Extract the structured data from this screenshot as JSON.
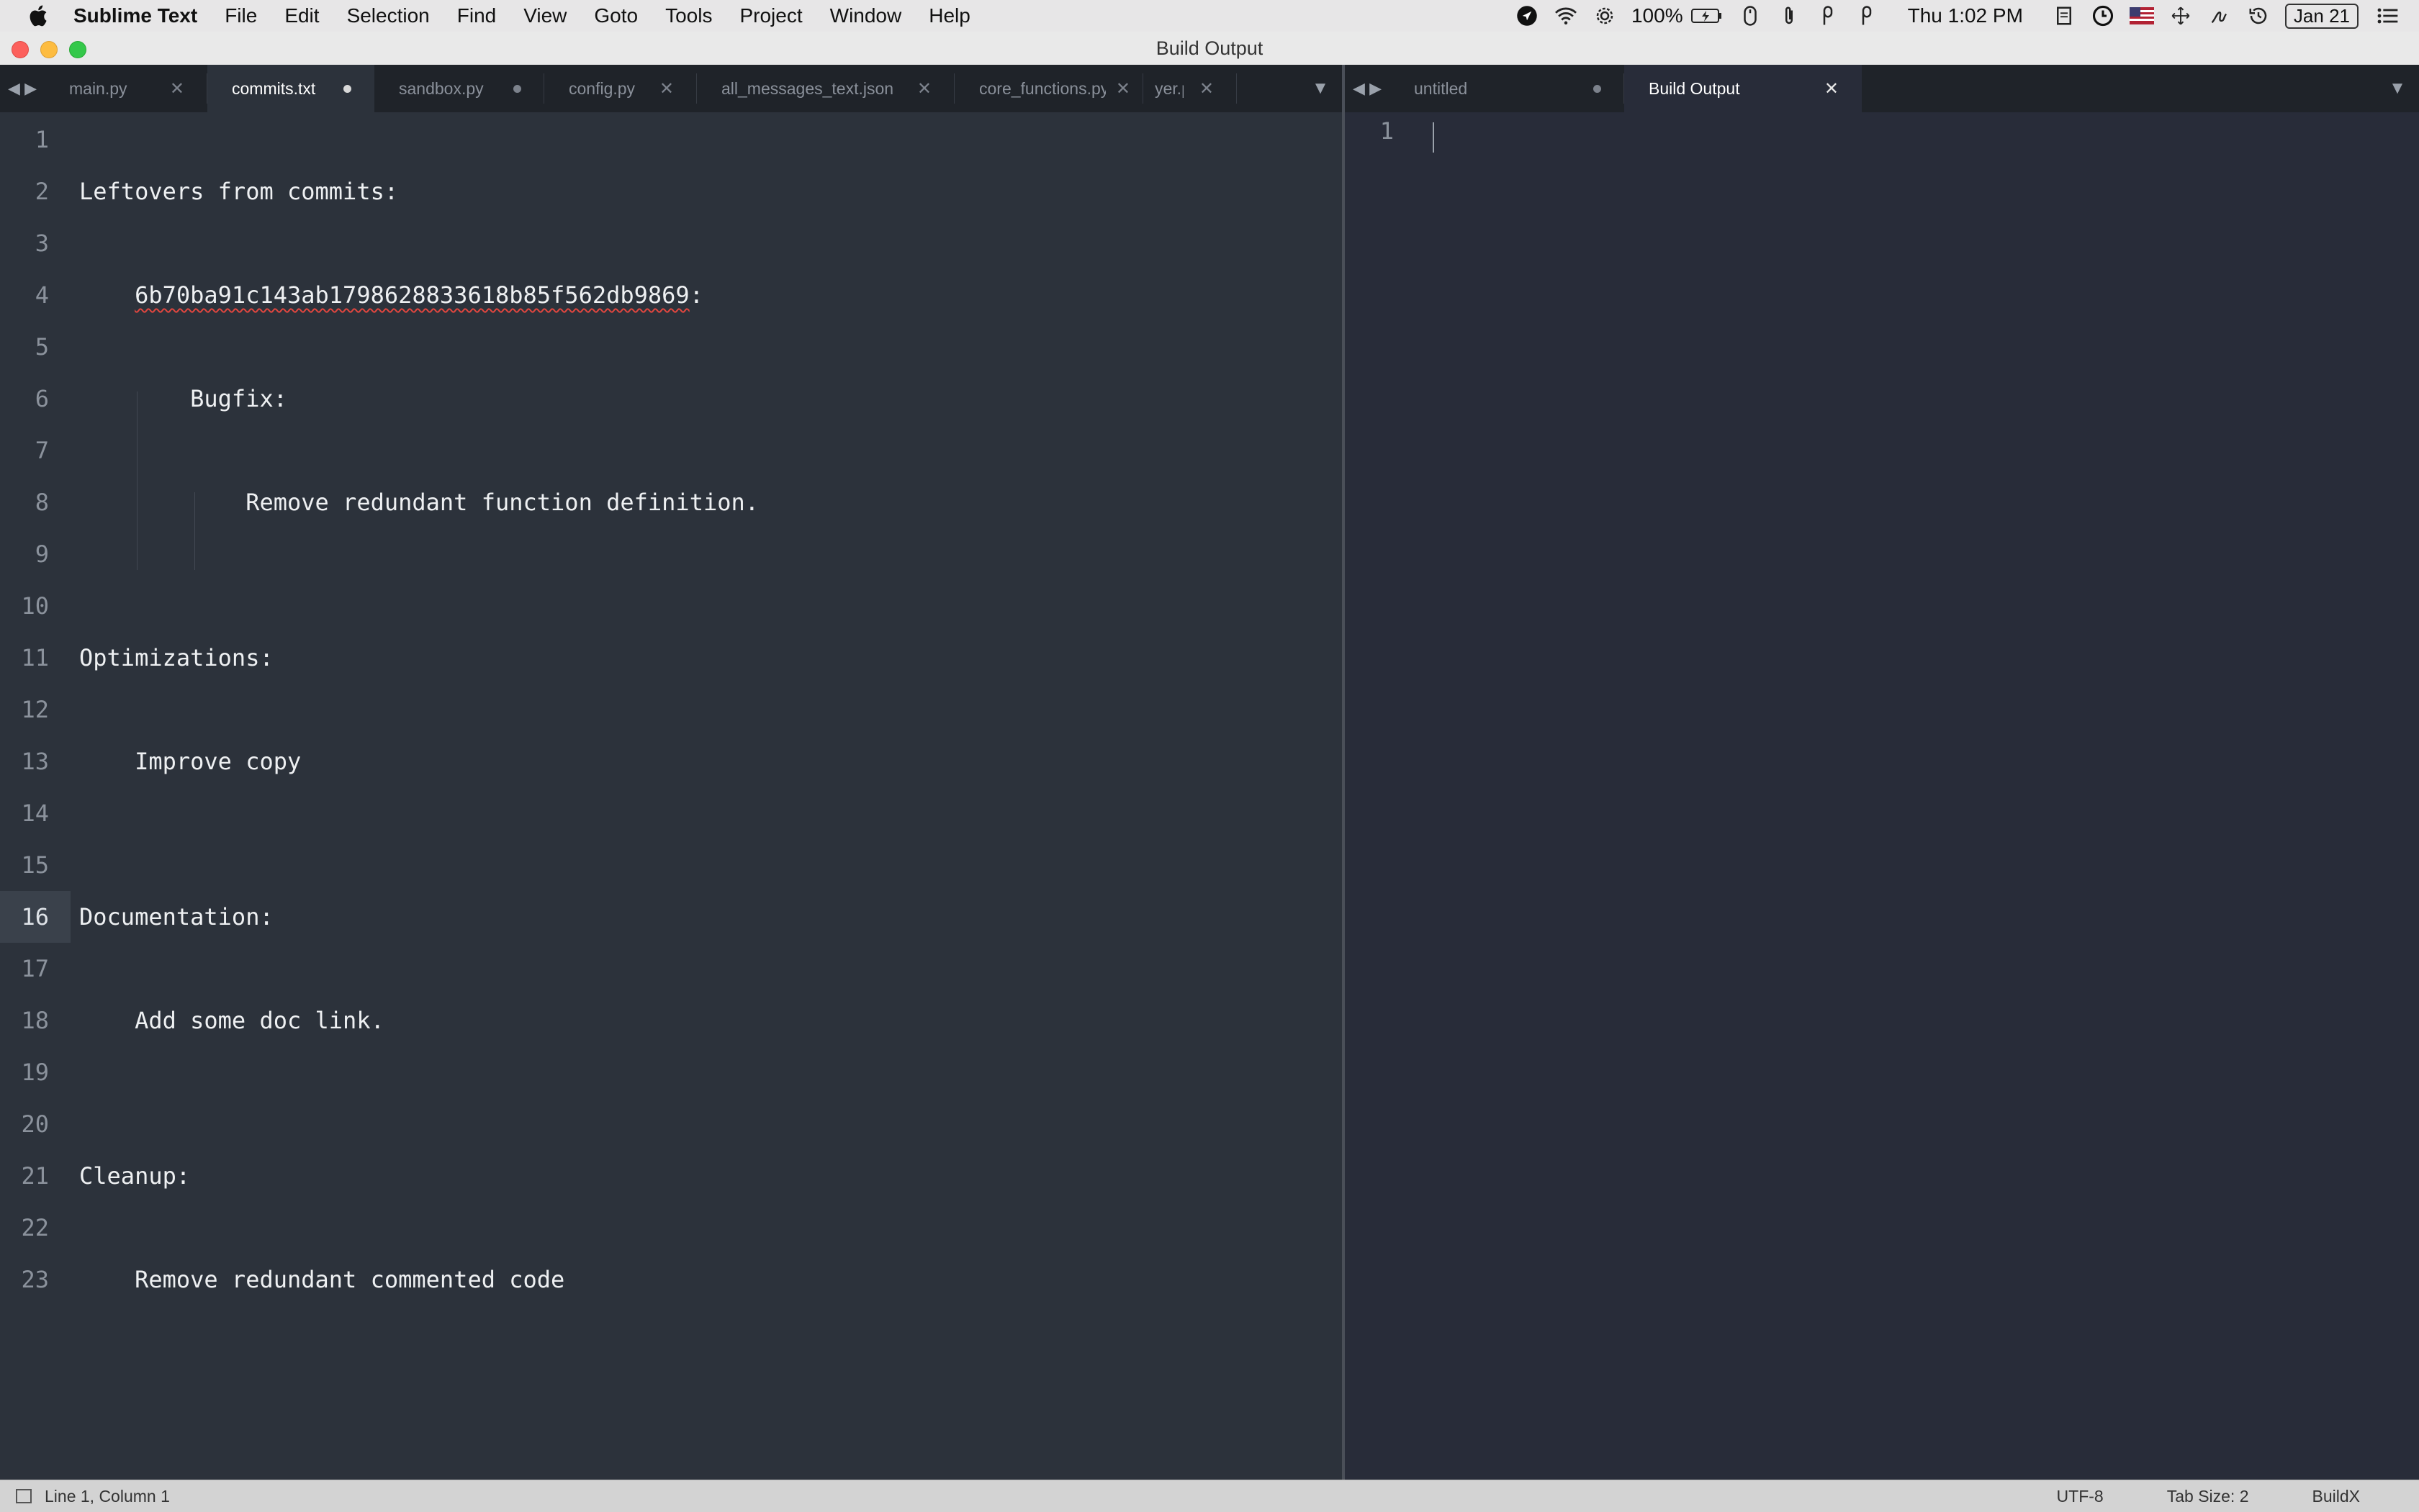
{
  "menubar": {
    "app_name": "Sublime Text",
    "items": [
      "File",
      "Edit",
      "Selection",
      "Find",
      "View",
      "Goto",
      "Tools",
      "Project",
      "Window",
      "Help"
    ],
    "battery": "100%",
    "clock": "Thu 1:02 PM",
    "date": "Jan 21"
  },
  "window": {
    "title": "Build Output"
  },
  "left_pane": {
    "tabs": [
      {
        "label": "main.py",
        "state": "close",
        "active": false
      },
      {
        "label": "commits.txt",
        "state": "dirty",
        "active": true
      },
      {
        "label": "sandbox.py",
        "state": "dirty",
        "active": false
      },
      {
        "label": "config.py",
        "state": "close",
        "active": false
      },
      {
        "label": "all_messages_text.json",
        "state": "close",
        "active": false
      },
      {
        "label": "core_functions.py",
        "state": "close",
        "active": false
      },
      {
        "label": "yer.py",
        "state": "close",
        "active": false
      }
    ],
    "lines": [
      {
        "n": "1",
        "text": ""
      },
      {
        "n": "2",
        "text": "Leftovers from commits:"
      },
      {
        "n": "3",
        "text": ""
      },
      {
        "n": "4",
        "text": "    6b70ba91c143ab1798628833618b85f562db9869:"
      },
      {
        "n": "5",
        "text": ""
      },
      {
        "n": "6",
        "text": "        Bugfix:"
      },
      {
        "n": "7",
        "text": ""
      },
      {
        "n": "8",
        "text": "            Remove redundant function definition."
      },
      {
        "n": "9",
        "text": ""
      },
      {
        "n": "10",
        "text": ""
      },
      {
        "n": "11",
        "text": "Optimizations:"
      },
      {
        "n": "12",
        "text": ""
      },
      {
        "n": "13",
        "text": "    Improve copy"
      },
      {
        "n": "14",
        "text": ""
      },
      {
        "n": "15",
        "text": ""
      },
      {
        "n": "16",
        "text": "Documentation:"
      },
      {
        "n": "17",
        "text": ""
      },
      {
        "n": "18",
        "text": "    Add some doc link."
      },
      {
        "n": "19",
        "text": ""
      },
      {
        "n": "20",
        "text": ""
      },
      {
        "n": "21",
        "text": "Cleanup:"
      },
      {
        "n": "22",
        "text": ""
      },
      {
        "n": "23",
        "text": "    Remove redundant commented code"
      }
    ],
    "current_line": "16"
  },
  "right_pane": {
    "tabs": [
      {
        "label": "untitled",
        "state": "dirty",
        "active": false
      },
      {
        "label": "Build Output",
        "state": "close",
        "active": true
      }
    ],
    "lines": [
      {
        "n": "1",
        "text": ""
      }
    ]
  },
  "statusbar": {
    "position": "Line 1, Column 1",
    "encoding": "UTF-8",
    "tab_size": "Tab Size: 2",
    "build_system": "BuildX"
  },
  "colors": {
    "editor_bg": "#2c323b",
    "output_bg": "#282c39",
    "tabbar_bg": "#1f2329",
    "spellcheck": "#e0463f"
  }
}
